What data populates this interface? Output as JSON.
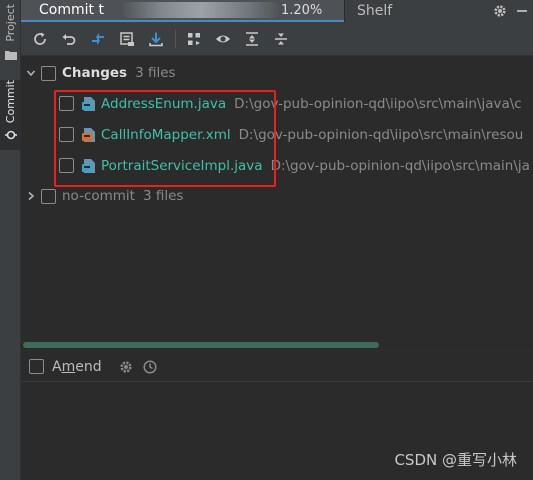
{
  "sidebar": {
    "project_label": "Project",
    "commit_label": "Commit"
  },
  "tabs": {
    "commit_tab": "Commit t",
    "commit_tab_tail": "1.20%",
    "shelf_tab": "Shelf"
  },
  "toolbar": {
    "buttons": [
      "refresh-icon",
      "rollback-icon",
      "diff-icon",
      "show-diff-editor-icon",
      "update-icon",
      "group-by-icon",
      "view-options-icon",
      "expand-all-icon",
      "collapse-all-icon"
    ]
  },
  "changes": {
    "label": "Changes",
    "count": "3 files",
    "files": [
      {
        "name": "AddressEnum.java",
        "path": "D:\\gov-pub-opinion-qd\\iipo\\src\\main\\java\\c",
        "icon": "java-class-icon"
      },
      {
        "name": "CallInfoMapper.xml",
        "path": "D:\\gov-pub-opinion-qd\\iipo\\src\\main\\resou",
        "icon": "xml-file-icon"
      },
      {
        "name": "PortraitServiceImpl.java",
        "path": "D:\\gov-pub-opinion-qd\\iipo\\src\\main\\ja",
        "icon": "java-class-icon"
      }
    ]
  },
  "no_commit": {
    "label": "no-commit",
    "count": "3 files"
  },
  "amend": {
    "label_pre": "A",
    "label_underlined": "m",
    "label_post": "end"
  },
  "watermark": "CSDN @重写小林",
  "colors": {
    "accent_tab": "#4a88c7",
    "filename": "#3fc0a8",
    "highlight_box": "#e8211f"
  }
}
